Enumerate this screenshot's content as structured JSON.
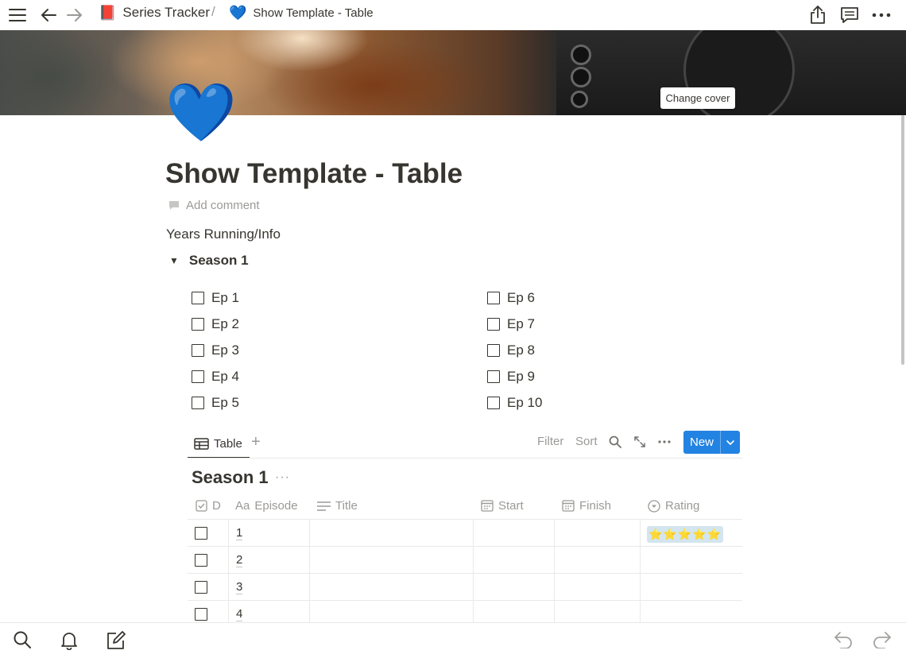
{
  "topbar": {
    "breadcrumb": [
      {
        "emoji": "📕",
        "label": "Series Tracker"
      },
      {
        "emoji": "💙",
        "label": "Show Template - Table"
      }
    ],
    "separator": "/"
  },
  "cover": {
    "change_cover_label": "Change cover"
  },
  "page": {
    "icon": "💙",
    "title": "Show Template - Table",
    "add_comment": "Add comment",
    "info_text": "Years Running/Info",
    "toggle_label": "Season 1",
    "toggle_glyph": "▼",
    "episodes_left": [
      "Ep 1",
      "Ep 2",
      "Ep 3",
      "Ep 4",
      "Ep 5"
    ],
    "episodes_right": [
      "Ep 6",
      "Ep 7",
      "Ep 8",
      "Ep 9",
      "Ep 10"
    ]
  },
  "database": {
    "view_tab": "Table",
    "add_view": "+",
    "filter": "Filter",
    "sort": "Sort",
    "new_label": "New",
    "title": "Season 1",
    "more": "···",
    "columns": [
      "D",
      "Episode",
      "Title",
      "Start",
      "Finish",
      "Rating"
    ],
    "column_icon_text": "Aa",
    "rows": [
      {
        "episode": "1",
        "rating": "⭐⭐⭐⭐⭐"
      },
      {
        "episode": "2",
        "rating": ""
      },
      {
        "episode": "3",
        "rating": ""
      },
      {
        "episode": "4",
        "rating": ""
      }
    ]
  },
  "colors": {
    "accent": "#2383e2",
    "rating_tag": "#d3e5ef",
    "text": "#37352f",
    "muted": "#9b9a97"
  }
}
